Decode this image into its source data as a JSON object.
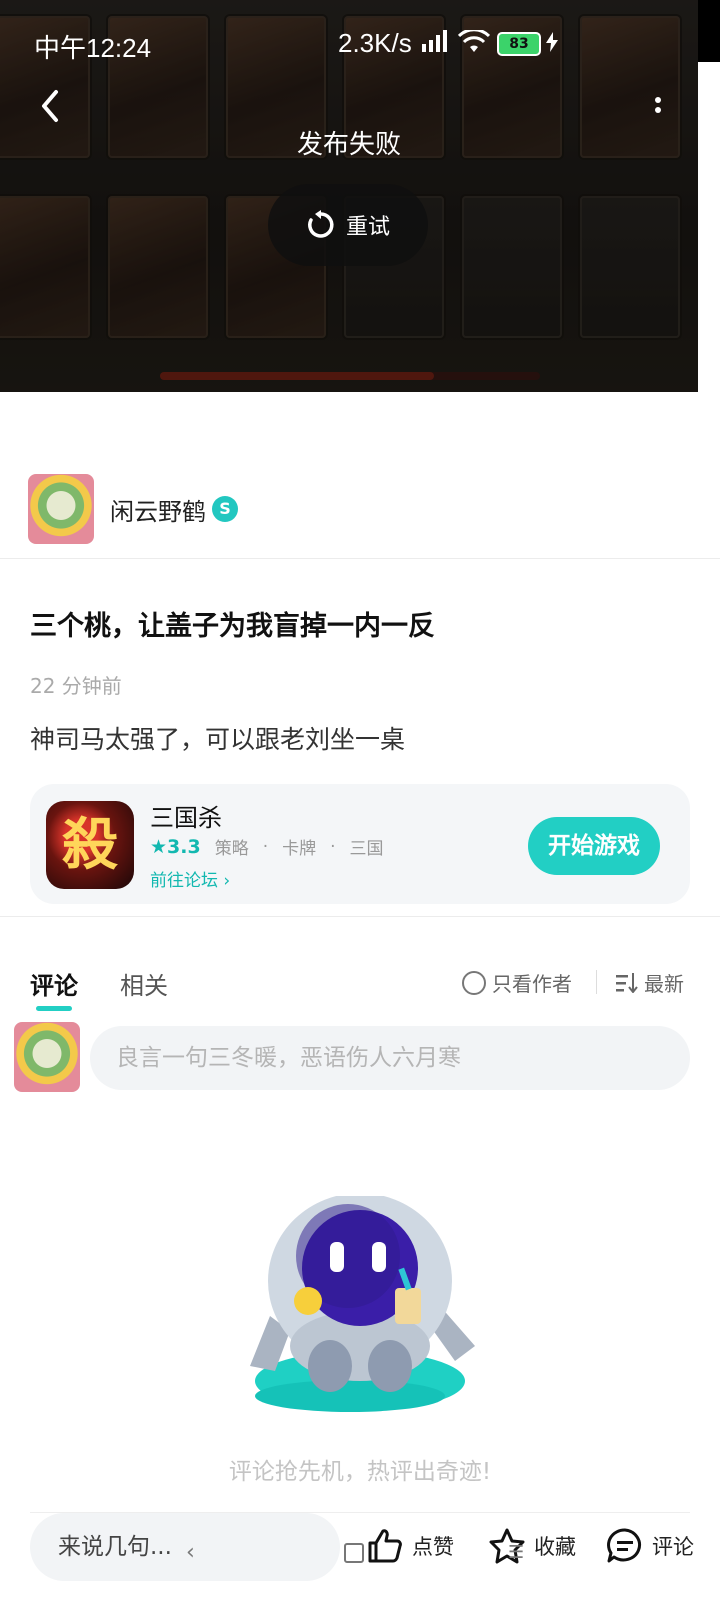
{
  "status_bar": {
    "time": "中午12:24",
    "network_speed": "2.3K/s",
    "battery": "83",
    "icons": [
      "signal-icon",
      "wifi-icon",
      "battery-icon",
      "charging-bolt-icon"
    ]
  },
  "header": {
    "publish_status": "发布失败",
    "retry_label": "重试",
    "icons": [
      "back-arrow-icon",
      "more-vertical-icon",
      "retry-icon"
    ]
  },
  "author": {
    "name": "闲云野鹤",
    "verify_badge": "S"
  },
  "post": {
    "title": "三个桃，让盖子为我盲掉一内一反",
    "time": "22 分钟前",
    "body": "神司马太强了，可以跟老刘坐一桌"
  },
  "game": {
    "icon_char": "殺",
    "name": "三国杀",
    "rating": "3.3",
    "tags": [
      "策略",
      "卡牌",
      "三国"
    ],
    "forum_link": "前往论坛",
    "start_button": "开始游戏"
  },
  "comments": {
    "tabs": [
      "评论",
      "相关"
    ],
    "only_author": "只看作者",
    "sort": "最新",
    "input_placeholder": "良言一句三冬暖，恶语伤人六月寒",
    "empty_text": "评论抢先机，热评出奇迹!"
  },
  "bottom_bar": {
    "say_placeholder": "来说几句...",
    "like_label": "点赞",
    "favorite_label": "收藏",
    "comment_label": "评论"
  },
  "colors": {
    "accent": "#22cfc4",
    "accent_text": "#12b8b0"
  }
}
